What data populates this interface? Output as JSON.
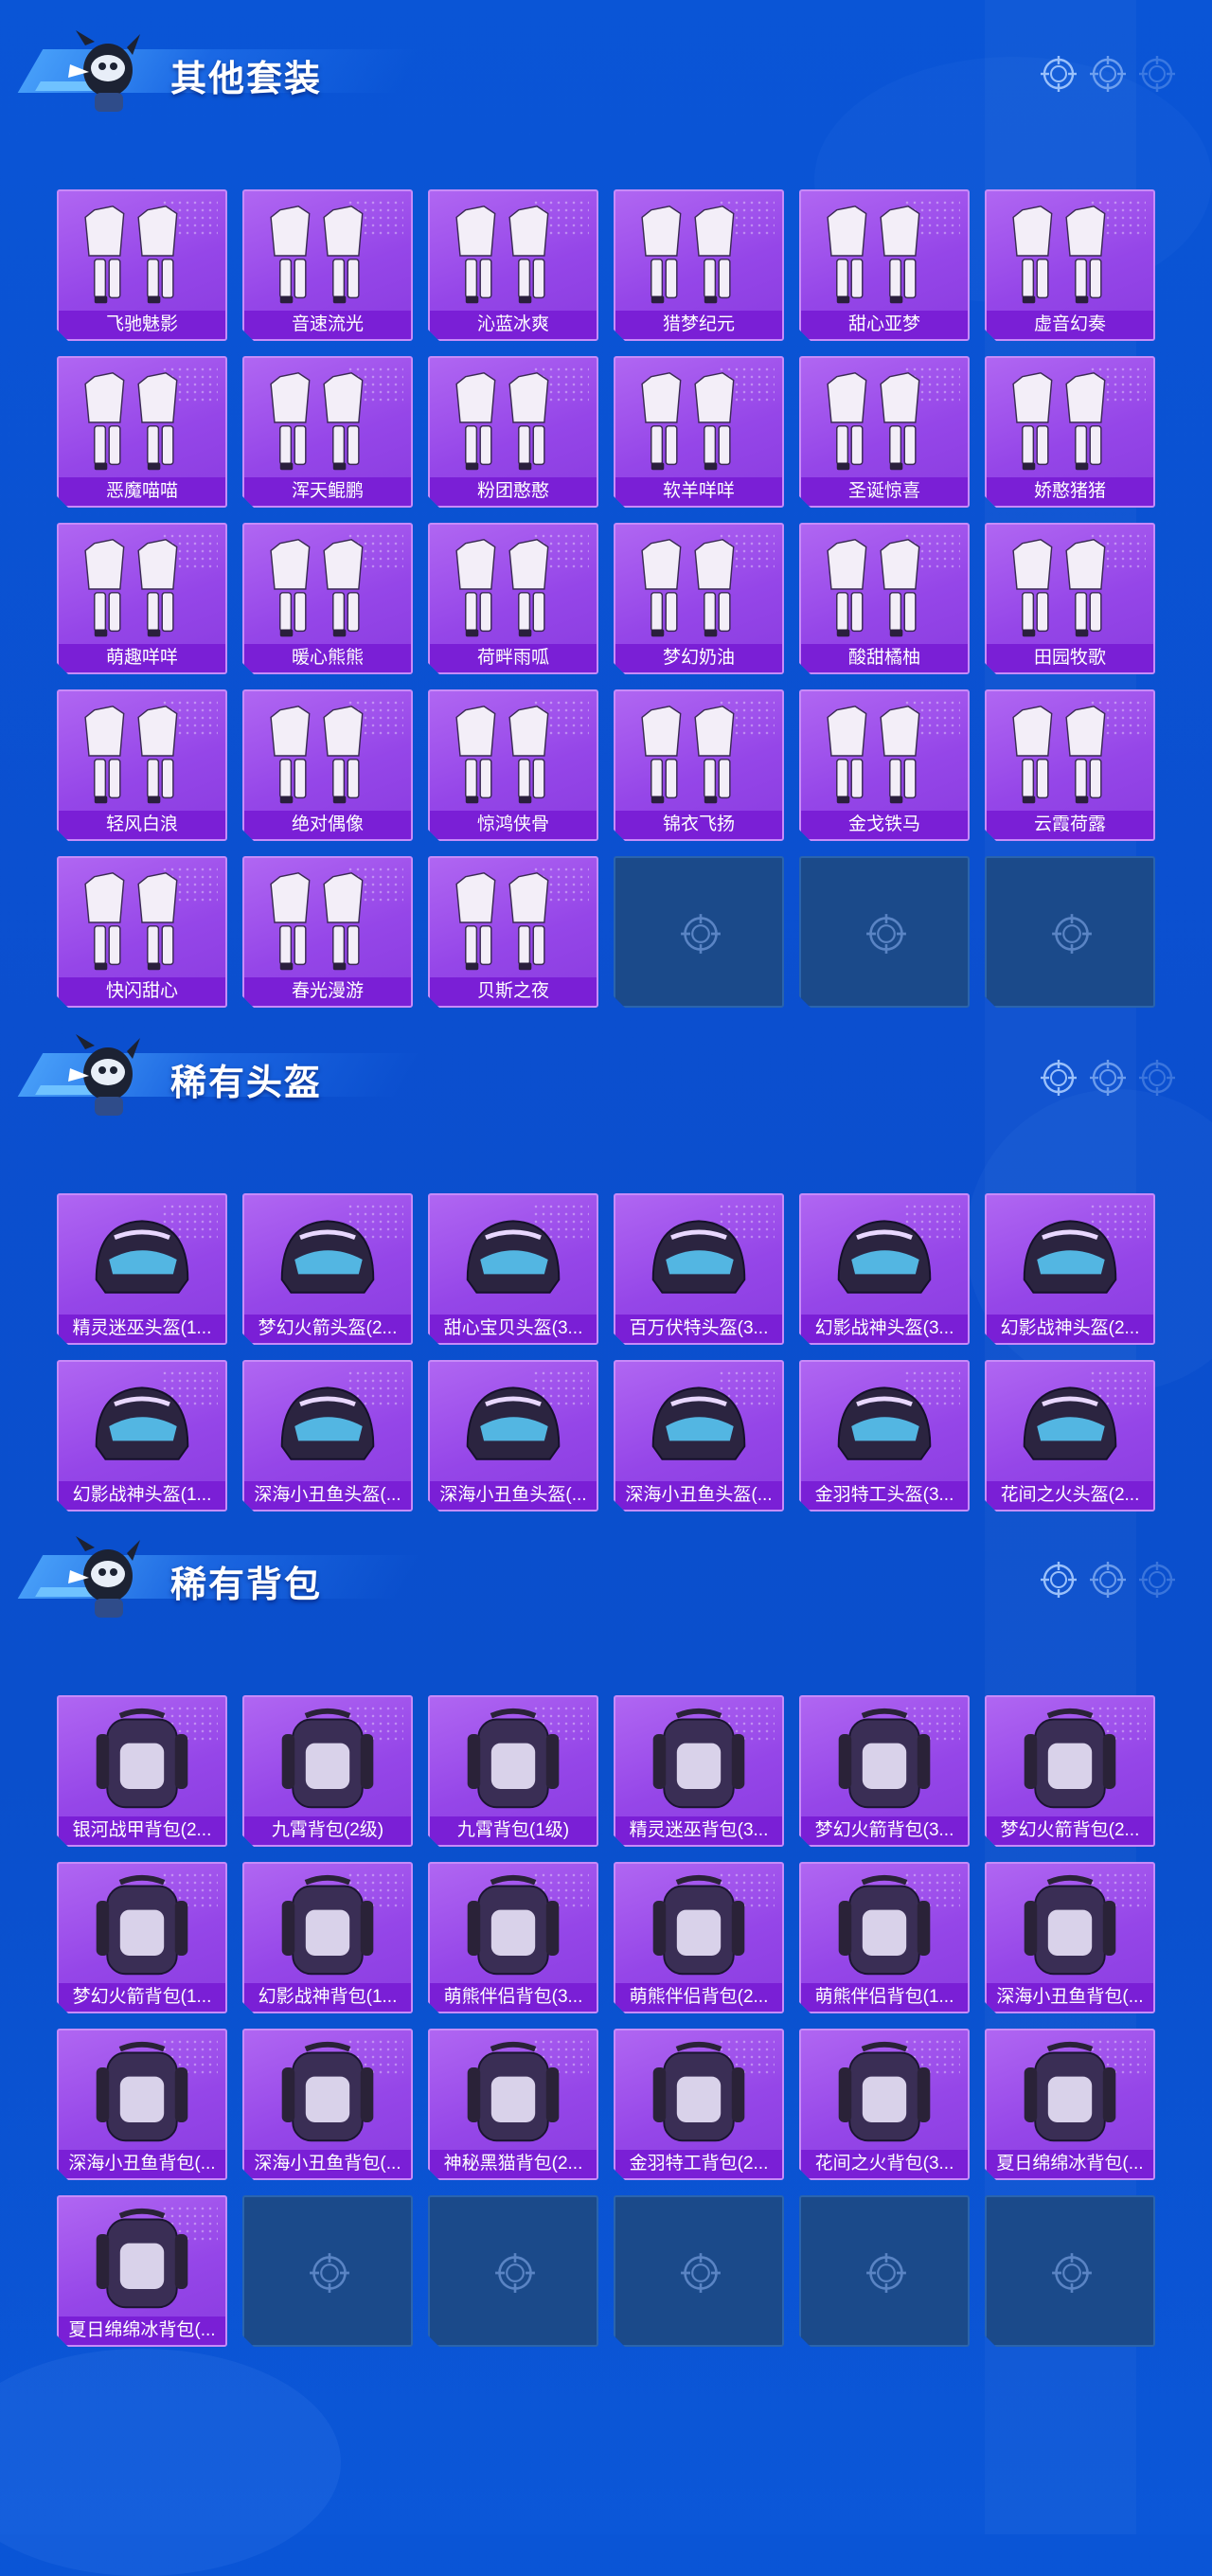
{
  "colors": {
    "background": "#0b4fcf",
    "card": "#9c4ced",
    "card_label_bg": "#7a1fd6",
    "empty_slot": "#1b4a8a"
  },
  "sections": [
    {
      "title": "其他套装",
      "icon": "outfit",
      "items": [
        "飞驰魅影",
        "音速流光",
        "沁蓝冰爽",
        "猎梦纪元",
        "甜心亚梦",
        "虚音幻奏",
        "恶魔喵喵",
        "浑天鲲鹏",
        "粉团憨憨",
        "软羊咩咩",
        "圣诞惊喜",
        "娇憨猪猪",
        "萌趣咩咩",
        "暖心熊熊",
        "荷畔雨呱",
        "梦幻奶油",
        "酸甜橘柚",
        "田园牧歌",
        "轻风白浪",
        "绝对偶像",
        "惊鸿侠骨",
        "锦衣飞扬",
        "金戈铁马",
        "云霞荷露",
        "快闪甜心",
        "春光漫游",
        "贝斯之夜"
      ],
      "empty_slots": 3
    },
    {
      "title": "稀有头盔",
      "icon": "helmet",
      "items": [
        "精灵迷巫头盔(1...",
        "梦幻火箭头盔(2...",
        "甜心宝贝头盔(3...",
        "百万伏特头盔(3...",
        "幻影战神头盔(3...",
        "幻影战神头盔(2...",
        "幻影战神头盔(1...",
        "深海小丑鱼头盔(...",
        "深海小丑鱼头盔(...",
        "深海小丑鱼头盔(...",
        "金羽特工头盔(3...",
        "花间之火头盔(2..."
      ],
      "empty_slots": 0
    },
    {
      "title": "稀有背包",
      "icon": "backpack",
      "items": [
        "银河战甲背包(2...",
        "九霄背包(2级)",
        "九霄背包(1级)",
        "精灵迷巫背包(3...",
        "梦幻火箭背包(3...",
        "梦幻火箭背包(2...",
        "梦幻火箭背包(1...",
        "幻影战神背包(1...",
        "萌熊伴侣背包(3...",
        "萌熊伴侣背包(2...",
        "萌熊伴侣背包(1...",
        "深海小丑鱼背包(...",
        "深海小丑鱼背包(...",
        "深海小丑鱼背包(...",
        "神秘黑猫背包(2...",
        "金羽特工背包(2...",
        "花间之火背包(3...",
        "夏日绵绵冰背包(...",
        "夏日绵绵冰背包(..."
      ],
      "empty_slots": 5
    }
  ]
}
